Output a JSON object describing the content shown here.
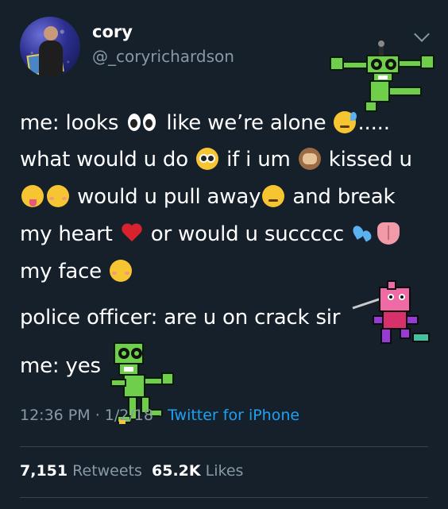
{
  "author": {
    "display_name": "cory",
    "handle": "@_coryrichardson"
  },
  "tweet": {
    "lines": [
      {
        "a": "me: looks ",
        "b": " like we’re alone ",
        "c": "....."
      },
      {
        "a": "what would u do ",
        "b": " if i um ",
        "c": " kissed u"
      },
      {
        "a": " would u pull away",
        "b": " and break"
      },
      {
        "a": "my heart ",
        "b": " or would u succccc "
      },
      {
        "a": "my face "
      },
      {
        "a": "police officer: are u on crack sir"
      },
      {
        "a": "me: yes"
      }
    ]
  },
  "emoji_names": [
    "eyes-icon",
    "sweat-smile-icon",
    "flushed-face-icon",
    "see-no-evil-monkey-icon",
    "tongue-out-face-icon",
    "blushing-face-icon",
    "disappointed-face-icon",
    "broken-heart-icon",
    "sweat-drops-icon",
    "tongue-icon",
    "smiling-face-icon"
  ],
  "meta": {
    "time": "12:36 PM",
    "sep1": " · ",
    "date": "1/2/18",
    "sep2": " · ",
    "source": "Twitter for iPhone"
  },
  "stats": {
    "retweets_count": "7,151",
    "retweets_label": "Retweets",
    "likes_count": "65.2K",
    "likes_label": "Likes"
  },
  "colors": {
    "background": "#15202b",
    "secondary_text": "#8899a6",
    "link": "#1da1f2",
    "divider": "#38444d"
  }
}
